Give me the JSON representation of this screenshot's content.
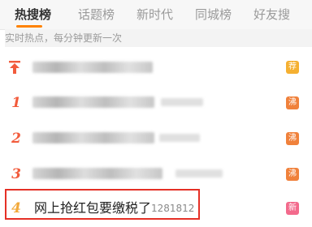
{
  "tabs": [
    {
      "label": "热搜榜",
      "active": true
    },
    {
      "label": "话题榜",
      "active": false
    },
    {
      "label": "新时代",
      "active": false
    },
    {
      "label": "同城榜",
      "active": false
    },
    {
      "label": "好友搜",
      "active": false
    }
  ],
  "subtitle": "实时热点，每分钟更新一次",
  "rows": [
    {
      "rank": "",
      "pinned": true,
      "badge": "荐",
      "badge_color": "#f5b031"
    },
    {
      "rank": "1",
      "badge": "沸",
      "badge_color": "#f0813b"
    },
    {
      "rank": "2",
      "badge": "沸",
      "badge_color": "#f0813b"
    },
    {
      "rank": "3",
      "badge": "沸",
      "badge_color": "#f0813b"
    },
    {
      "rank": "4",
      "title": "网上抢红包要缴税了",
      "count": "1281812",
      "badge": "新",
      "badge_color": "#f36a8c"
    }
  ],
  "colors": {
    "accent": "#ff8200",
    "rank": "#f25b3c",
    "highlight": "#e53026"
  }
}
